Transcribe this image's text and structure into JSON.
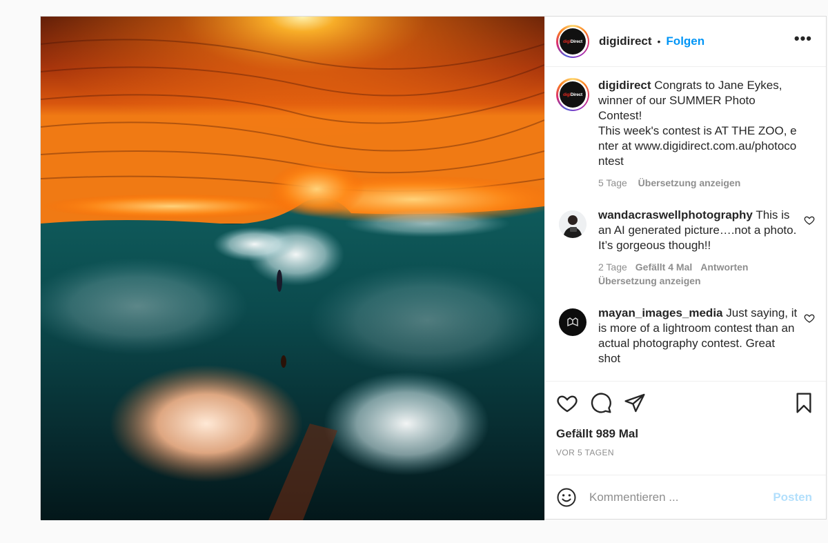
{
  "post": {
    "photo_description_icon": "ai-wave-surf-image",
    "author": {
      "username": "digidirect",
      "logo_text_red": "digi",
      "logo_text_white": "Direct",
      "separator": "•",
      "follow_label": "Folgen",
      "more_icon": "more-horizontal-icon",
      "more_label": "•••"
    },
    "caption": {
      "username": "digidirect",
      "text_line1": "Congrats to Jane Eykes, winner of our SUMMER Photo Contest!",
      "text_line2": "This week's contest is AT THE ZOO, enter at www.digidirect.com.au/photocontest",
      "time": "5 Tage",
      "translate_label": "Übersetzung anzeigen"
    },
    "comments": [
      {
        "username": "wandacraswellphotography",
        "text": "This is an AI generated picture….not a photo. It’s gorgeous though!!",
        "time": "2 Tage",
        "likes": "Gefällt 4 Mal",
        "reply_label": "Antworten",
        "translate_label": "Übersetzung anzeigen"
      },
      {
        "username": "mayan_images_media",
        "text": "Just saying, it is more of a lightroom contest than an actual photography contest. Great shot"
      }
    ],
    "likes_text": "Gefällt 989 Mal",
    "date_text": "VOR 5 TAGEN",
    "comment_input": {
      "placeholder": "Kommentieren ...",
      "post_label": "Posten"
    },
    "colors": {
      "accent_blue": "#0095f6",
      "post_disabled": "#b2dffc",
      "muted": "#8e8e8e"
    }
  }
}
